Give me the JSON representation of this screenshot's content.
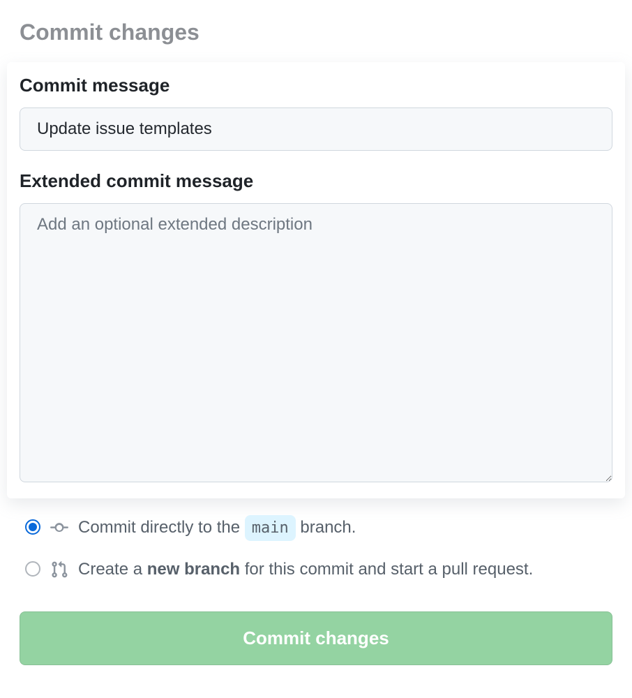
{
  "header": {
    "title": "Commit changes"
  },
  "commit_message": {
    "label": "Commit message",
    "value": "Update issue templates"
  },
  "extended_message": {
    "label": "Extended commit message",
    "placeholder": "Add an optional extended description",
    "value": ""
  },
  "branch_options": {
    "direct": {
      "prefix": "Commit directly to the ",
      "branch_name": "main",
      "suffix": " branch.",
      "selected": true
    },
    "new_branch": {
      "prefix": "Create a ",
      "bold": "new branch",
      "suffix": " for this commit and start a pull request.",
      "selected": false
    }
  },
  "actions": {
    "commit_label": "Commit changes"
  }
}
